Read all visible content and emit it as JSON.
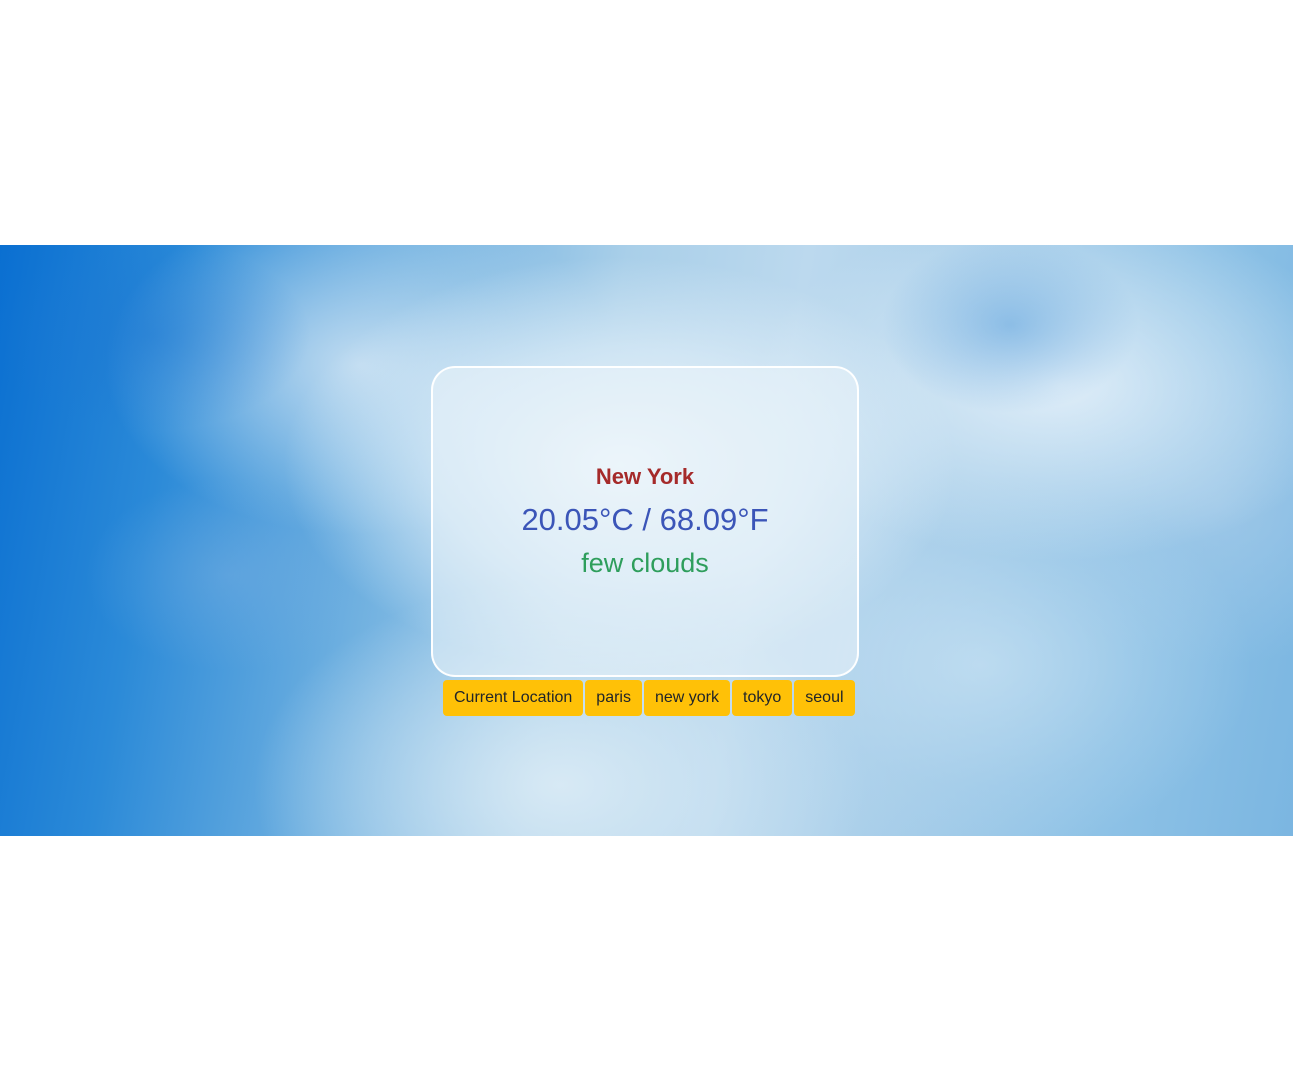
{
  "weather": {
    "city": "New York",
    "temperature": "20.05°C / 68.09°F",
    "description": "few clouds"
  },
  "buttons": {
    "current_location": "Current Location",
    "paris": "paris",
    "new_york": "new york",
    "tokyo": "tokyo",
    "seoul": "seoul"
  },
  "colors": {
    "city_text": "#a52a2a",
    "temperature_text": "#3b55b8",
    "description_text": "#2e9e5c",
    "button_background": "#ffc107"
  }
}
